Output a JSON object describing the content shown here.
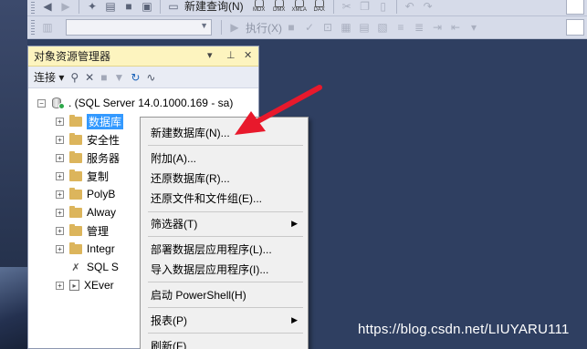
{
  "toolbar": {
    "new_query": "新建查询(N)",
    "badges": [
      "MDX",
      "DMX",
      "XMLA",
      "DAX"
    ],
    "execute": "执行(X)"
  },
  "object_explorer": {
    "title": "对象资源管理器",
    "pin_glyph": "▾ ⊥ ✕",
    "connect_label": "连接 ▾",
    "tree": {
      "server": ". (SQL Server 14.0.1000.169 - sa)",
      "items": [
        {
          "label": "数据库",
          "selected": true,
          "icon": "folder-icon"
        },
        {
          "label": "安全性",
          "icon": "folder-icon"
        },
        {
          "label": "服务器",
          "icon": "folder-icon"
        },
        {
          "label": "复制",
          "icon": "folder-icon"
        },
        {
          "label": "PolyB",
          "icon": "folder-icon"
        },
        {
          "label": "Alway",
          "icon": "folder-icon"
        },
        {
          "label": "管理",
          "icon": "folder-icon"
        },
        {
          "label": "Integr",
          "icon": "folder-icon"
        },
        {
          "label": "SQL S",
          "icon": "agent-icon"
        },
        {
          "label": "XEver",
          "icon": "xevent-icon"
        }
      ]
    }
  },
  "context_menu": {
    "items": [
      {
        "label": "新建数据库(N)...",
        "submenu": false
      },
      {
        "label": "附加(A)...",
        "submenu": false
      },
      {
        "label": "还原数据库(R)...",
        "submenu": false
      },
      {
        "label": "还原文件和文件组(E)...",
        "submenu": false
      },
      {
        "label": "筛选器(T)",
        "submenu": true
      },
      {
        "label": "部署数据层应用程序(L)...",
        "submenu": false
      },
      {
        "label": "导入数据层应用程序(I)...",
        "submenu": false
      },
      {
        "label": "启动 PowerShell(H)",
        "submenu": false
      },
      {
        "label": "报表(P)",
        "submenu": true
      },
      {
        "label": "刷新(F)",
        "submenu": false
      }
    ]
  },
  "annotation": {
    "color": "#e8192c"
  },
  "watermark": "https://blog.csdn.net/LIUYARU111"
}
